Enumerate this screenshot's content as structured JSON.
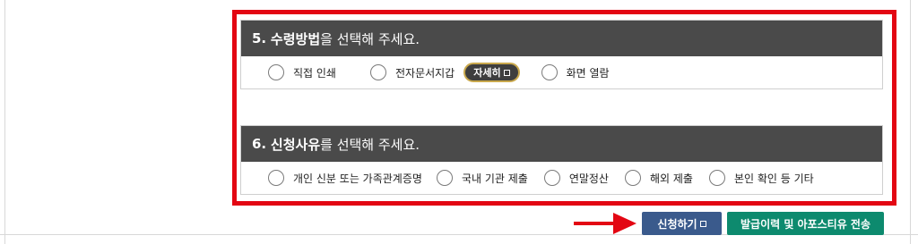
{
  "section5": {
    "number": "5.",
    "title_bold": "수령방법",
    "title_rest": "을 선택해 주세요.",
    "options": [
      "직접 인쇄",
      "전자문서지갑",
      "화면 열람"
    ],
    "detail_button": "자세히"
  },
  "section6": {
    "number": "6.",
    "title_bold": "신청사유",
    "title_rest": "를 선택해 주세요.",
    "options": [
      "개인 신분 또는 가족관계증명",
      "국내 기관 제출",
      "연말정산",
      "해외 제출",
      "본인 확인 등 기타"
    ]
  },
  "actions": {
    "apply_button": "신청하기",
    "history_button": "발급이력 및 아포스티유 전송"
  },
  "colors": {
    "highlight_border": "#e30613",
    "header_bg": "#4a4a4a",
    "apply_bg": "#3a5a8c",
    "history_bg": "#0d8a6e",
    "arrow": "#e30613"
  }
}
